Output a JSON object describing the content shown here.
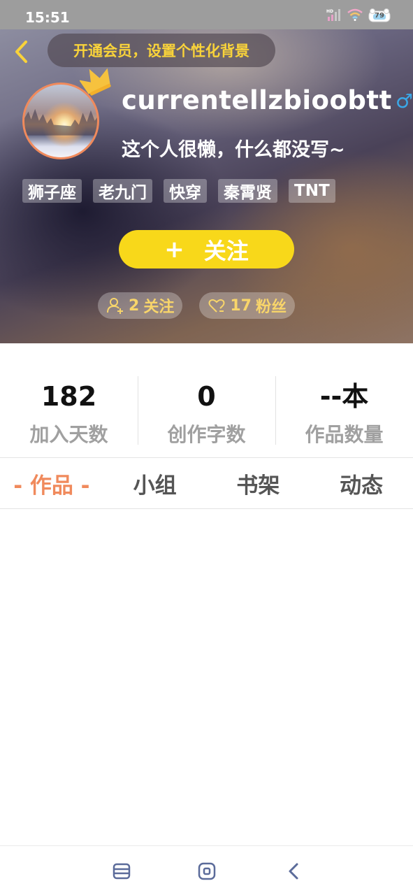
{
  "status_bar": {
    "time": "15:51",
    "icons": [
      "hd-signal-icon",
      "wifi-icon",
      "battery-icon"
    ],
    "battery": "79"
  },
  "header": {
    "vip_banner": "开通会员，设置个性化背景",
    "username": "currentellzbioobtt",
    "gender_symbol": "♂",
    "bio": "这个人很懒，什么都没写~",
    "tags": [
      "狮子座",
      "老九门",
      "快穿",
      "秦霄贤",
      "TNT"
    ],
    "follow_button": {
      "plus": "+",
      "label": "关注"
    },
    "following": {
      "count": "2",
      "label": "关注"
    },
    "fans": {
      "count": "17",
      "label": "粉丝"
    }
  },
  "stats": [
    {
      "value": "182",
      "label": "加入天数"
    },
    {
      "value": "0",
      "label": "创作字数"
    },
    {
      "value": "--本",
      "label": "作品数量"
    }
  ],
  "tabs": [
    {
      "label": "- 作品 -",
      "active": true
    },
    {
      "label": "小组",
      "active": false
    },
    {
      "label": "书架",
      "active": false
    },
    {
      "label": "动态",
      "active": false
    }
  ],
  "colors": {
    "accent_orange": "#f08a5c",
    "follow_yellow": "#f8d81a",
    "banner_text": "#f9d33a",
    "gender_blue": "#3aa8e8"
  }
}
